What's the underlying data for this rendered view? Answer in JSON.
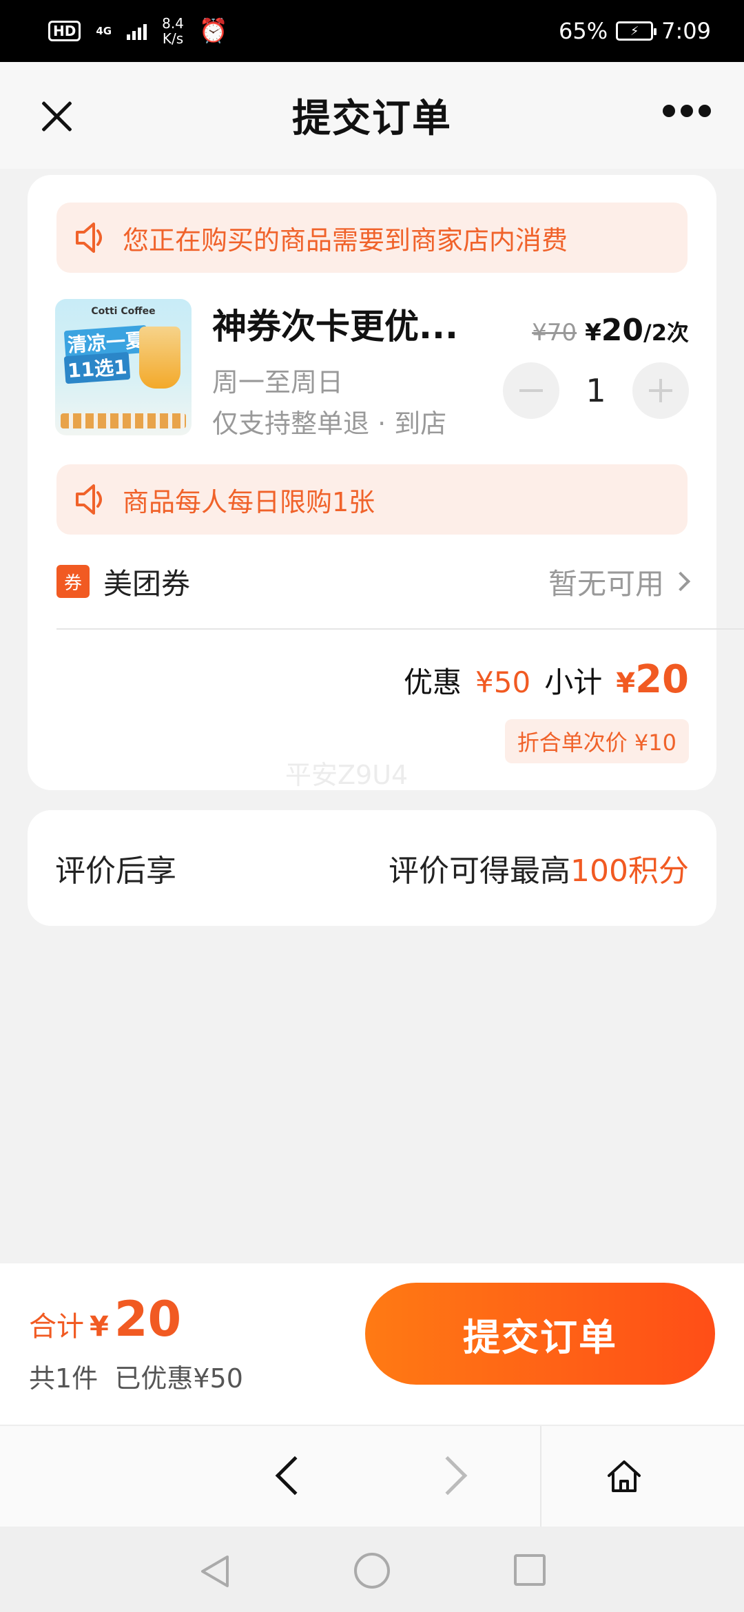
{
  "status_bar": {
    "hd": "HD",
    "network": "4G",
    "speed_value": "8.4",
    "speed_unit": "K/s",
    "battery_percent": "65%",
    "time": "7:09"
  },
  "header": {
    "title": "提交订单"
  },
  "order": {
    "store_notice": "您正在购买的商品需要到商家店内消费",
    "product": {
      "image_brand": "Cotti Coffee",
      "image_line1": "清凉一夏",
      "image_line2": "11选1",
      "name": "神券次卡更优...",
      "schedule": "周一至周日",
      "refund_policy": "仅支持整单退 · 到店",
      "original_price": "¥70",
      "price_symbol": "¥",
      "price": "20",
      "price_unit": "/2次",
      "quantity": "1"
    },
    "limit_notice": "商品每人每日限购1张",
    "coupon": {
      "badge": "券",
      "label": "美团券",
      "status": "暂无可用"
    },
    "discount_label": "优惠",
    "discount_value": "¥50",
    "subtotal_label": "小计",
    "subtotal_symbol": "¥",
    "subtotal_value": "20",
    "unit_price_note": "折合单次价 ¥10",
    "watermark": "平安Z9U4"
  },
  "review": {
    "left": "评价后享",
    "right_prefix": "评价可得最高",
    "right_highlight": "100积分"
  },
  "bottom_bar": {
    "total_label": "合计",
    "total_symbol": "¥",
    "total_value": "20",
    "summary": "共1件  已优惠¥50",
    "submit_label": "提交订单"
  },
  "colors": {
    "accent": "#f15a22",
    "notice_bg": "#fdeee8",
    "button_start": "#ff7a14",
    "button_end": "#ff4e17"
  }
}
